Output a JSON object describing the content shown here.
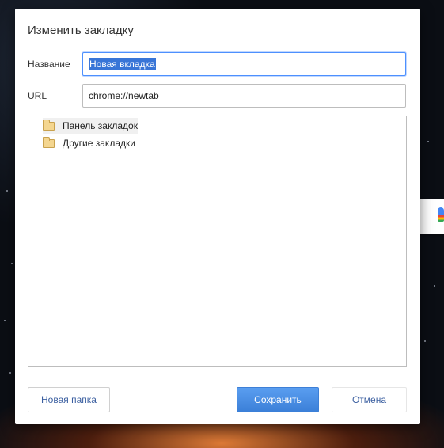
{
  "dialog": {
    "title": "Изменить закладку",
    "name_label": "Название",
    "name_value": "Новая вкладка",
    "url_label": "URL",
    "url_value": "chrome://newtab",
    "folders": [
      {
        "label": "Панель закладок",
        "icon": "folder-icon"
      },
      {
        "label": "Другие закладки",
        "icon": "folder-icon"
      }
    ],
    "buttons": {
      "new_folder": "Новая папка",
      "save": "Сохранить",
      "cancel": "Отмена"
    }
  },
  "colors": {
    "accent": "#4d90fe",
    "selection": "#3875d7"
  }
}
